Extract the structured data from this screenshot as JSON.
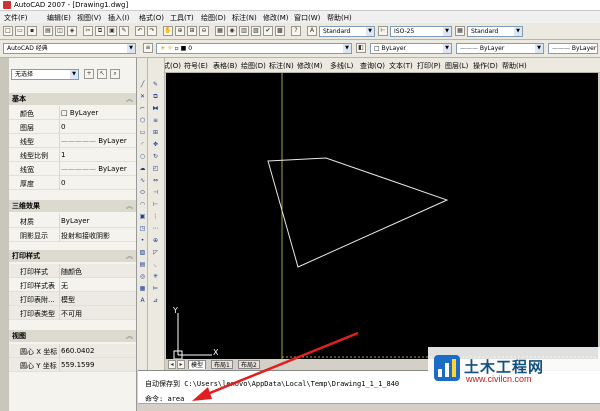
{
  "window": {
    "title": "AutoCAD 2007 - [Drawing1.dwg]",
    "menu": [
      "文件(F)",
      "编辑(E)",
      "视图(V)",
      "插入(I)",
      "格式(O)",
      "工具(T)",
      "绘图(D)",
      "标注(N)",
      "修改(M)",
      "窗口(W)",
      "帮助(H)"
    ]
  },
  "toolbars": {
    "workspace": "AutoCAD 经典",
    "text_style": "Standard",
    "dim_style": "ISO-25",
    "table_style": "Standard",
    "layer": "0",
    "color": "ByLayer",
    "linetype": "ByLayer",
    "lineweight": "ByLayer"
  },
  "docked_menu": [
    "格式(O)",
    "符号(E)",
    "表格(B)",
    "绘图(D)",
    "标注(N)",
    "修改(M)",
    "多线(L)",
    "查询(Q)",
    "文本(T)",
    "打印(P)",
    "图层(L)",
    "操作(D)",
    "帮助(H)"
  ],
  "properties": {
    "selection": "无选择",
    "sections": {
      "basic": {
        "title": "基本",
        "rows": [
          {
            "key": "颜色",
            "value": "ByLayer"
          },
          {
            "key": "图层",
            "value": "0"
          },
          {
            "key": "线型",
            "value": "ByLayer"
          },
          {
            "key": "线型比例",
            "value": "1"
          },
          {
            "key": "线宽",
            "value": "ByLayer"
          },
          {
            "key": "厚度",
            "value": "0"
          }
        ]
      },
      "three_d": {
        "title": "三维效果",
        "rows": [
          {
            "key": "材质",
            "value": "ByLayer"
          },
          {
            "key": "阴影显示",
            "value": "投射和接收阴影"
          }
        ]
      },
      "plot": {
        "title": "打印样式",
        "rows": [
          {
            "key": "打印样式",
            "value": "随颜色"
          },
          {
            "key": "打印样式表",
            "value": "无"
          },
          {
            "key": "打印表附...",
            "value": "模型"
          },
          {
            "key": "打印表类型",
            "value": "不可用"
          }
        ]
      },
      "view": {
        "title": "视图",
        "rows": [
          {
            "key": "圆心 X 坐标",
            "value": "660.0402"
          },
          {
            "key": "圆心 Y 坐标",
            "value": "559.1599"
          }
        ]
      }
    }
  },
  "tabs": [
    "模型",
    "布局1",
    "布局2"
  ],
  "command": {
    "history": "自动保存到 C:\\Users\\lenovo\\AppData\\Local\\Temp\\Drawing1_1_1_840",
    "prompt": "命令:",
    "input": "area"
  },
  "ucs": {
    "x": "X",
    "y": "Y"
  },
  "watermark": {
    "title": "土木工程网",
    "url": "www.civilcn.com"
  }
}
